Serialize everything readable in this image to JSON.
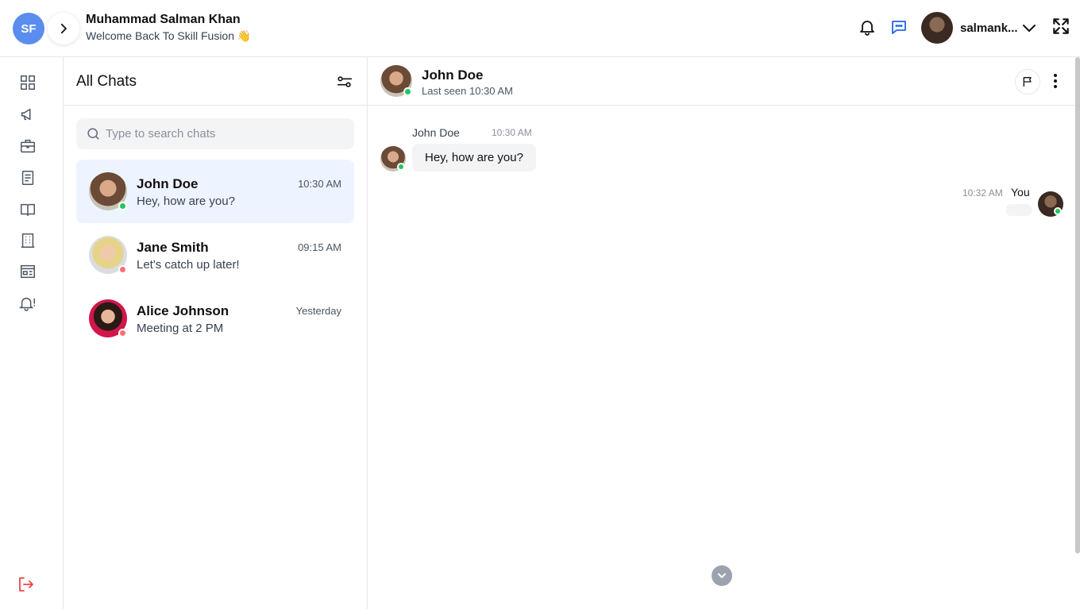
{
  "header": {
    "logo_text": "SF",
    "user_name": "Muhammad Salman Khan",
    "welcome": "Welcome Back To Skill Fusion 👋",
    "username_short": "salmank...",
    "accent_color": "#2563eb"
  },
  "rail": {
    "icons": [
      "dashboard-icon",
      "megaphone-icon",
      "briefcase-icon",
      "document-icon",
      "book-icon",
      "building-icon",
      "newspaper-icon",
      "alert-bell-icon"
    ],
    "logout_icon": "logout-icon"
  },
  "chat_list": {
    "title": "All Chats",
    "search_placeholder": "Type to search chats",
    "chats": [
      {
        "name": "John Doe",
        "preview": "Hey, how are you?",
        "time": "10:30 AM",
        "status": "online",
        "active": true
      },
      {
        "name": "Jane Smith",
        "preview": "Let's catch up later!",
        "time": "09:15 AM",
        "status": "offline",
        "active": false
      },
      {
        "name": "Alice Johnson",
        "preview": "Meeting at 2 PM",
        "time": "Yesterday",
        "status": "offline",
        "active": false
      }
    ]
  },
  "conversation": {
    "contact_name": "John Doe",
    "last_seen": "Last seen 10:30 AM",
    "messages": [
      {
        "sender": "John Doe",
        "time": "10:30 AM",
        "text": "Hey, how are you?",
        "direction": "in"
      },
      {
        "sender": "You",
        "time": "10:32 AM",
        "text": "",
        "direction": "out"
      }
    ]
  }
}
